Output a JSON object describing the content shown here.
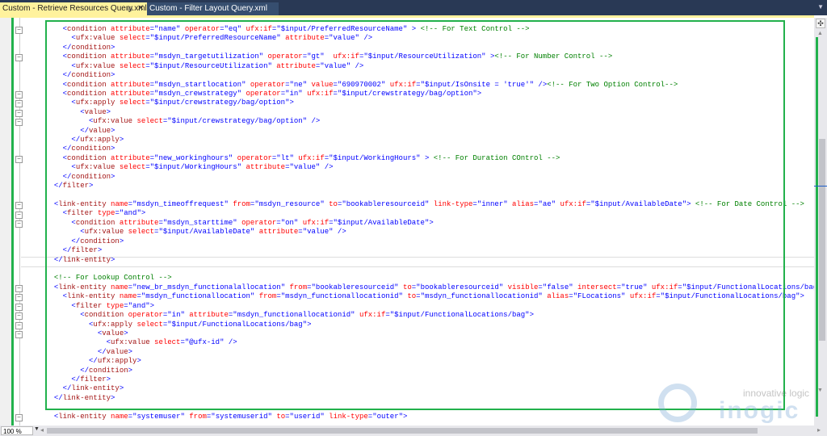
{
  "tabs": [
    {
      "label": "Custom - Retrieve Resources Query.xml",
      "active": true,
      "pin_icon": "pin-icon",
      "close_icon": "close-icon"
    },
    {
      "label": "Custom - Filter Layout Query.xml",
      "active": false
    }
  ],
  "editor": {
    "lines": [
      "    <condition attribute=\"name\" operator=\"eq\" ufx:if=\"$input/PreferredResourceName\" > <!-- For Text Control -->",
      "      <ufx:value select=\"$input/PreferredResourceName\" attribute=\"value\" />",
      "    </condition>",
      "    <condition attribute=\"msdyn_targetutilization\" operator=\"gt\"  ufx:if=\"$input/ResourceUtilization\" ><!-- For Number Control -->",
      "      <ufx:value select=\"$input/ResourceUtilization\" attribute=\"value\" />",
      "    </condition>",
      "    <condition attribute=\"msdyn_startlocation\" operator=\"ne\" value=\"690970002\" ufx:if=\"$input/IsOnsite = 'true'\" /><!-- For Two Option Control-->",
      "    <condition attribute=\"msdyn_crewstrategy\" operator=\"in\" ufx:if=\"$input/crewstrategy/bag/option\">",
      "      <ufx:apply select=\"$input/crewstrategy/bag/option\">",
      "        <value>",
      "          <ufx:value select=\"$input/crewstrategy/bag/option\" />",
      "        </value>",
      "      </ufx:apply>",
      "    </condition>",
      "    <condition attribute=\"new_workinghours\" operator=\"lt\" ufx:if=\"$input/WorkingHours\" > <!-- For Duration COntrol -->",
      "      <ufx:value select=\"$input/WorkingHours\" attribute=\"value\" />",
      "    </condition>",
      "  </filter>",
      "",
      "  <link-entity name=\"msdyn_timeoffrequest\" from=\"msdyn_resource\" to=\"bookableresourceid\" link-type=\"inner\" alias=\"ae\" ufx:if=\"$input/AvailableDate\"> <!-- For Date Control -->",
      "    <filter type=\"and\">",
      "      <condition attribute=\"msdyn_starttime\" operator=\"on\" ufx:if=\"$input/AvailableDate\">",
      "        <ufx:value select=\"$input/AvailableDate\" attribute=\"value\" />",
      "      </condition>",
      "    </filter>",
      "  </link-entity>",
      "",
      "  <!-- For Lookup Control -->",
      "  <link-entity name=\"new_br_msdyn_functionalallocation\" from=\"bookableresourceid\" to=\"bookableresourceid\" visible=\"false\" intersect=\"true\" ufx:if=\"$input/FunctionalLocations/bag\">",
      "    <link-entity name=\"msdyn_functionallocation\" from=\"msdyn_functionallocationid\" to=\"msdyn_functionallocationid\" alias=\"FLocations\" ufx:if=\"$input/FunctionalLocations/bag\">",
      "      <filter type=\"and\">",
      "        <condition operator=\"in\" attribute=\"msdyn_functionallocationid\" ufx:if=\"$input/FunctionalLocations/bag\">",
      "          <ufx:apply select=\"$input/FunctionalLocations/bag\">",
      "            <value>",
      "              <ufx:value select=\"@ufx-id\" />",
      "            </value>",
      "          </ufx:apply>",
      "        </condition>",
      "      </filter>",
      "    </link-entity>",
      "  </link-entity>",
      "",
      "  <link-entity name=\"systemuser\" from=\"systemuserid\" to=\"userid\" link-type=\"outer\">"
    ],
    "fold_lines": [
      0,
      3,
      7,
      8,
      9,
      10,
      14,
      19,
      20,
      21,
      28,
      29,
      30,
      31,
      32,
      33,
      42
    ]
  },
  "status": {
    "zoom": "100 %"
  },
  "watermark": {
    "line1": "innovative logic",
    "line2": "inogic"
  },
  "colors": {
    "accent_green": "#22b14c",
    "tab_active": "#FFF29D",
    "tabbar": "#293955"
  }
}
